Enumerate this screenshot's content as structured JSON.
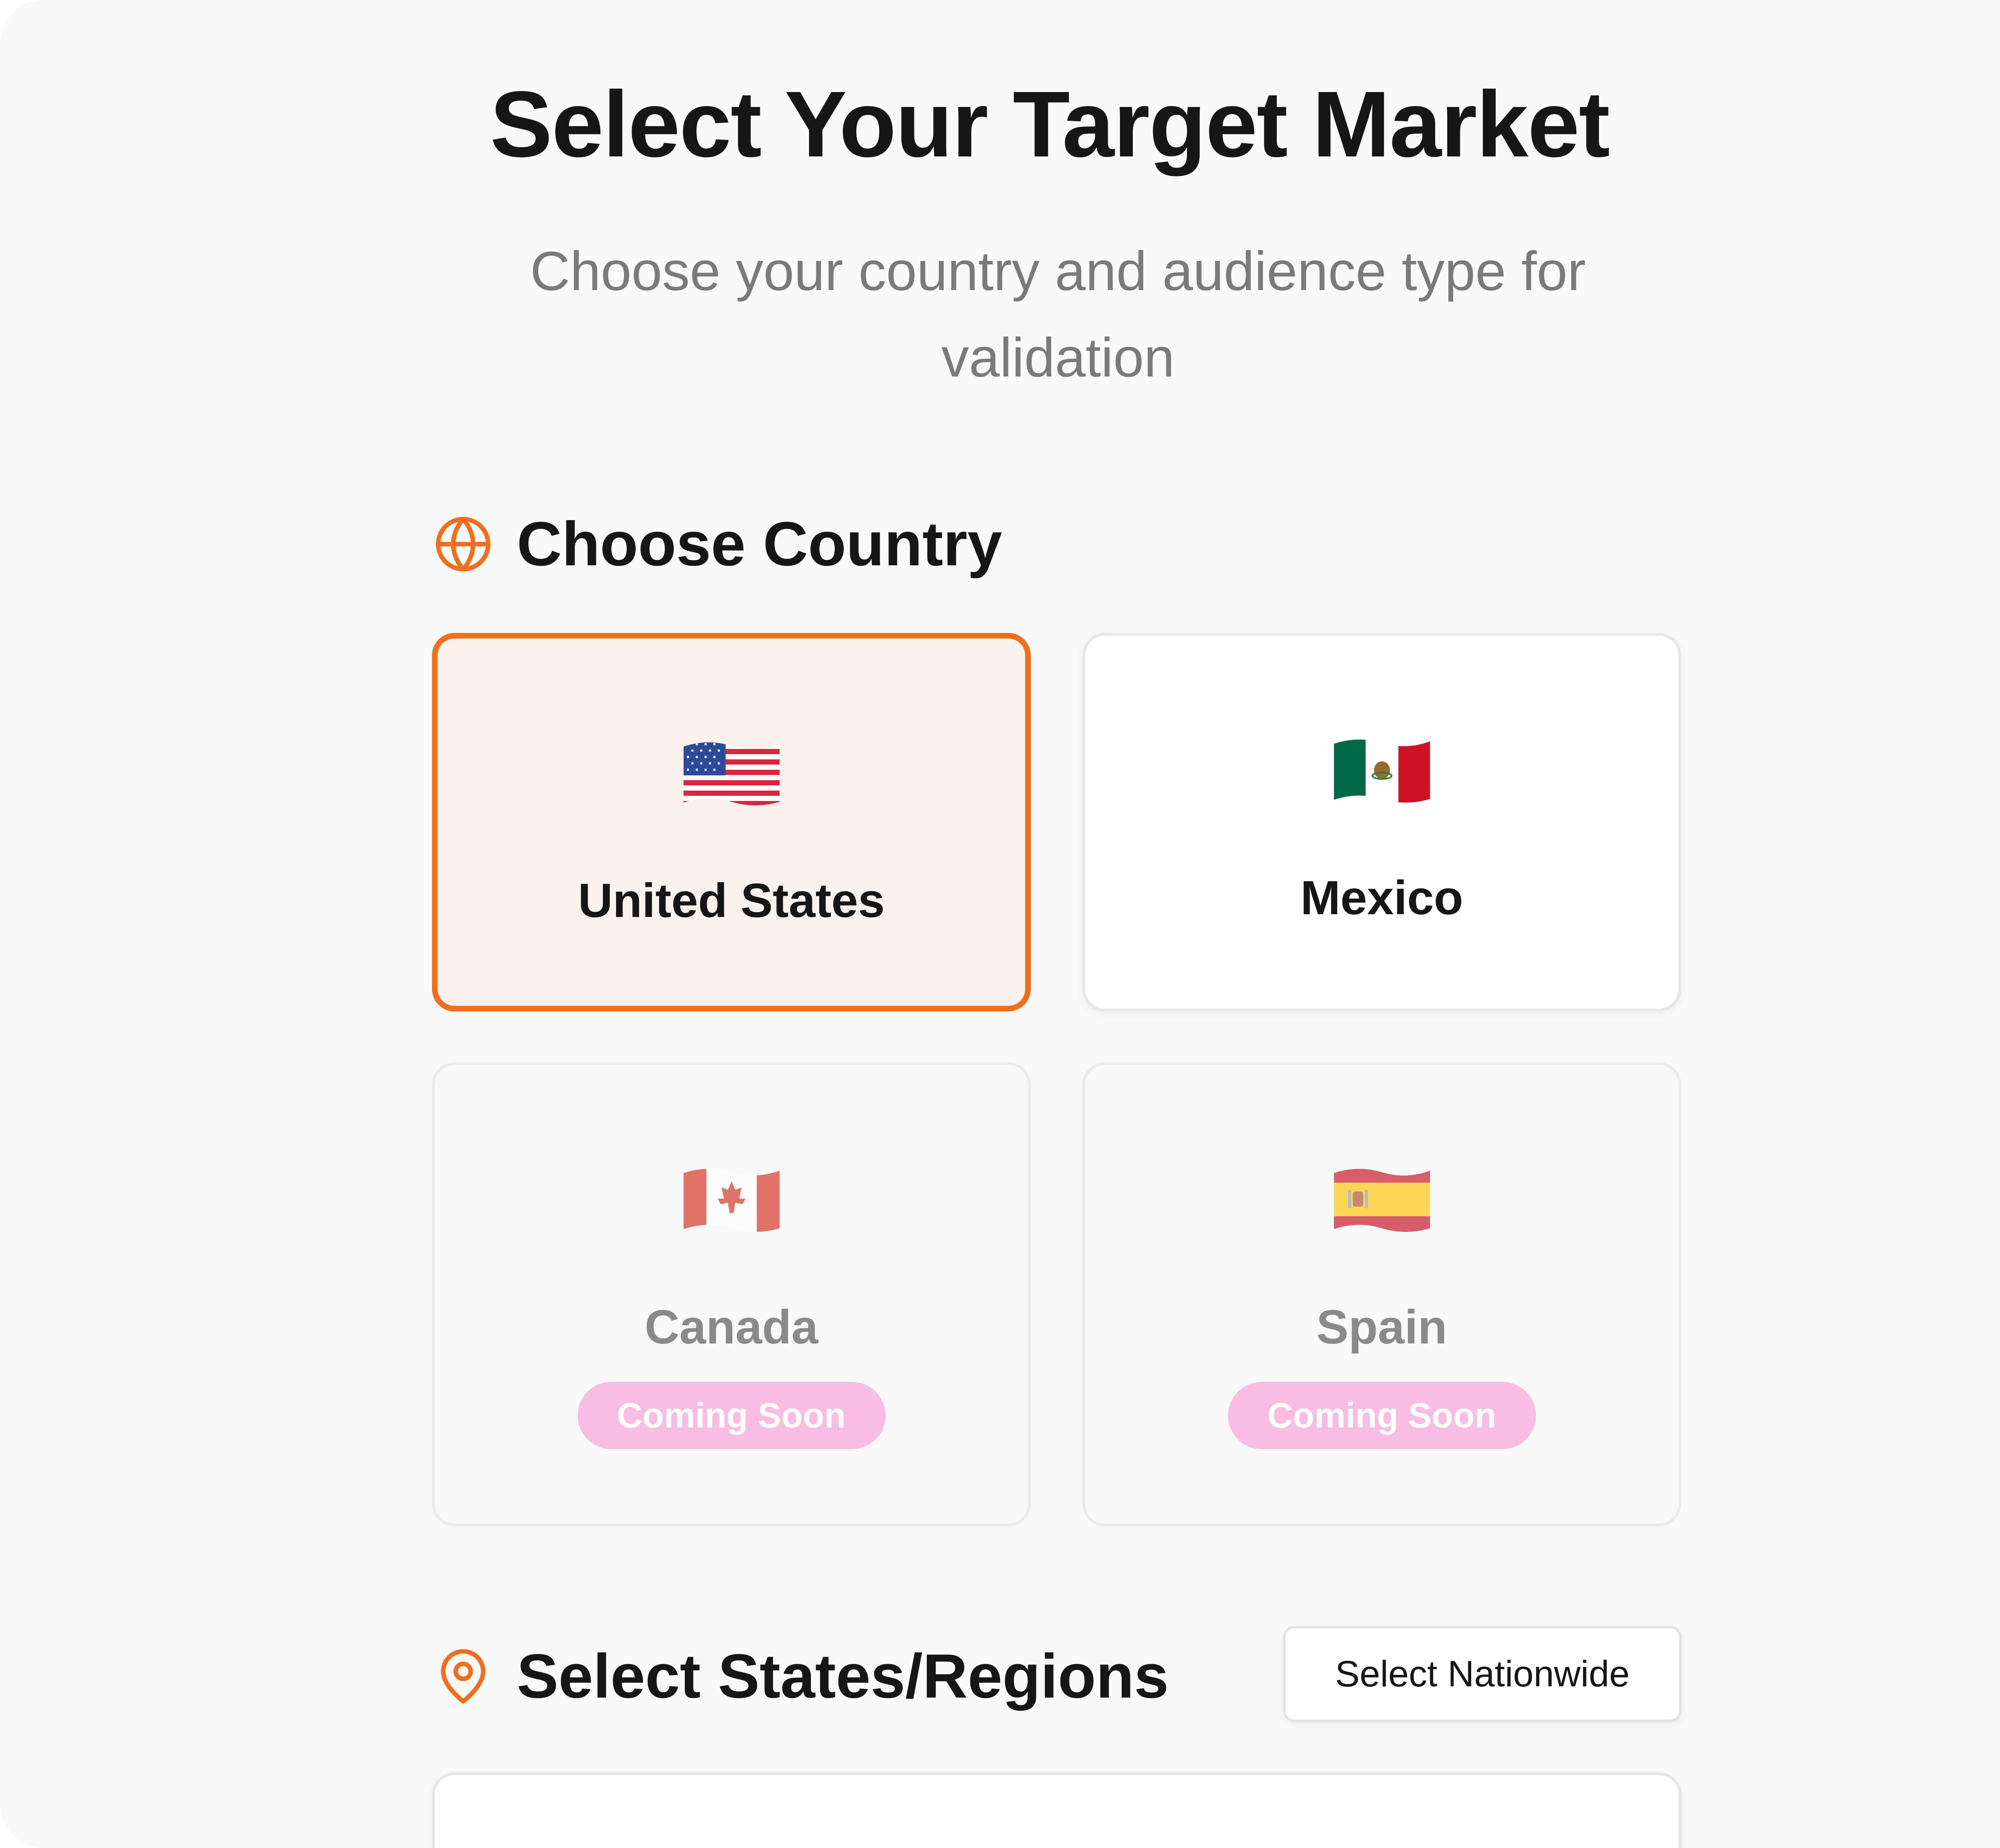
{
  "page": {
    "title": "Select Your Target Market",
    "subtitle": "Choose your country and audience type for validation"
  },
  "country_section": {
    "heading": "Choose Country",
    "icon": "globe-icon",
    "countries": [
      {
        "name": "United States",
        "flag": "us-flag-icon",
        "selected": true,
        "available": true
      },
      {
        "name": "Mexico",
        "flag": "mexico-flag-icon",
        "selected": false,
        "available": true
      },
      {
        "name": "Canada",
        "flag": "canada-flag-icon",
        "selected": false,
        "available": false,
        "badge": "Coming Soon"
      },
      {
        "name": "Spain",
        "flag": "spain-flag-icon",
        "selected": false,
        "available": false,
        "badge": "Coming Soon"
      }
    ]
  },
  "regions_section": {
    "heading": "Select States/Regions",
    "icon": "map-pin-icon",
    "nationwide_button": "Select Nationwide"
  },
  "colors": {
    "accent": "#f26e1c",
    "selected_background": "#fbf1ed",
    "badge_background": "#f9bde3",
    "page_background": "#f9f9f9"
  }
}
